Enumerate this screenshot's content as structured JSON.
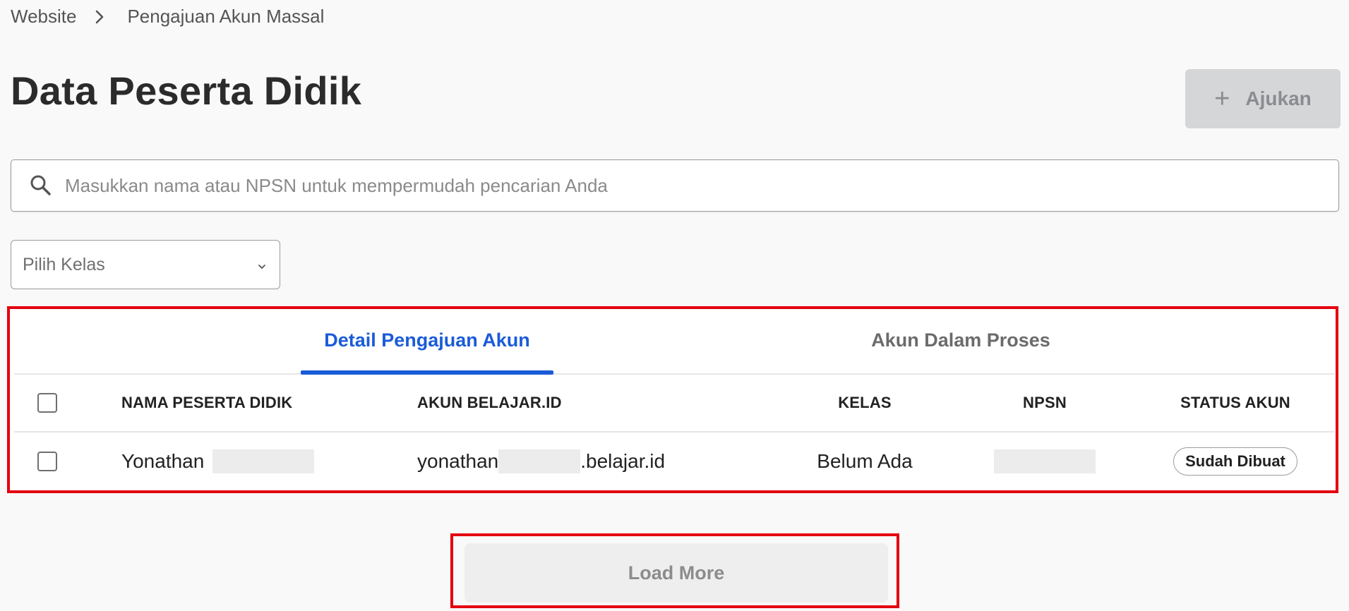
{
  "breadcrumb": {
    "root": "Website",
    "current": "Pengajuan Akun Massal"
  },
  "header": {
    "title": "Data Peserta Didik",
    "ajukan_label": "Ajukan",
    "ajukan_icon": "plus-icon"
  },
  "search": {
    "placeholder": "Masukkan nama atau NPSN untuk mempermudah pencarian Anda",
    "value": "",
    "icon": "search-icon"
  },
  "filter": {
    "kelas_label": "Pilih Kelas",
    "icon": "chevron-down-icon"
  },
  "tabs": [
    {
      "label": "Detail Pengajuan Akun",
      "active": true
    },
    {
      "label": "Akun Dalam Proses",
      "active": false
    }
  ],
  "table": {
    "columns": [
      "NAMA PESERTA DIDIK",
      "AKUN BELAJAR.ID",
      "KELAS",
      "NPSN",
      "STATUS AKUN"
    ],
    "rows": [
      {
        "nama_prefix": "Yonathan",
        "akun_prefix": "yonathan",
        "akun_suffix": ".belajar.id",
        "kelas": "Belum Ada",
        "npsn": "",
        "status": "Sudah Dibuat"
      }
    ]
  },
  "load_more_label": "Load More",
  "colors": {
    "accent_blue": "#1a5bd8",
    "highlight_red": "#e4000f",
    "disabled_button": "#d5d6d8"
  }
}
